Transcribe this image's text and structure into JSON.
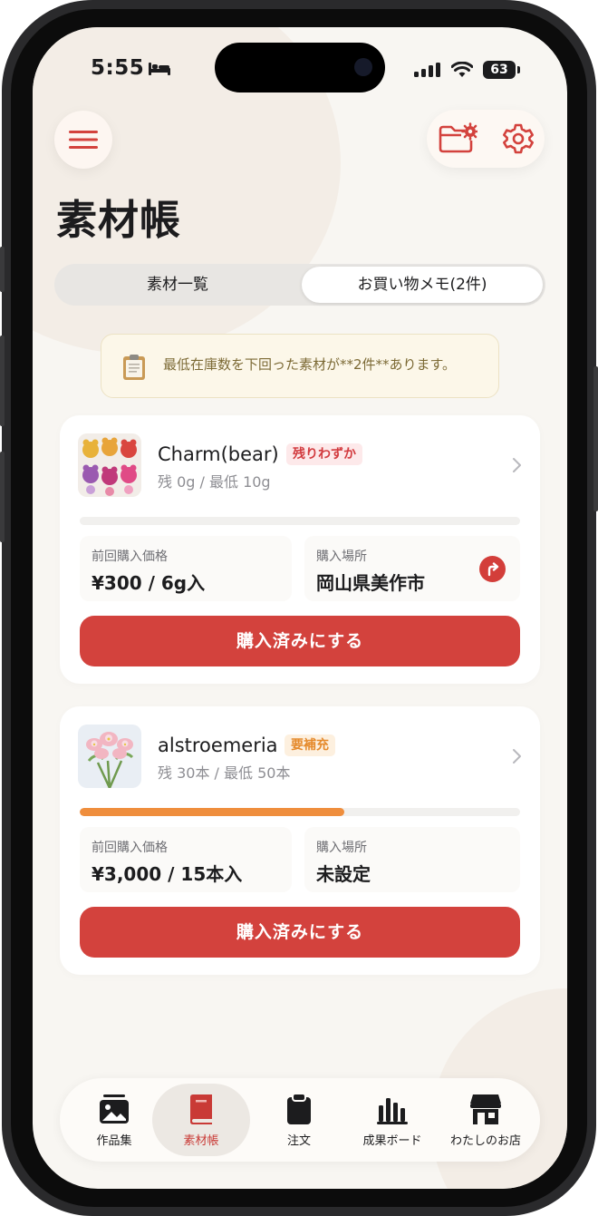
{
  "status_bar": {
    "time": "5:55",
    "battery": "63"
  },
  "header": {
    "title": "素材帳"
  },
  "segments": [
    {
      "label": "素材一覧",
      "selected": false
    },
    {
      "label": "お買い物メモ(2件)",
      "selected": true
    }
  ],
  "notice": {
    "text": "最低在庫数を下回った素材が**2件**あります。"
  },
  "items": [
    {
      "name": "Charm(bear)",
      "badge": "残りわずか",
      "stock": "残 0g / 最低 10g",
      "progress": 0,
      "price_label": "前回購入価格",
      "price": "¥300 / 6g入",
      "place_label": "購入場所",
      "place": "岡山県美作市",
      "button": "購入済みにする"
    },
    {
      "name": "alstroemeria",
      "badge": "要補充",
      "stock": "残 30本 / 最低 50本",
      "progress": 0.6,
      "price_label": "前回購入価格",
      "price": "¥3,000 / 15本入",
      "place_label": "購入場所",
      "place": "未設定",
      "button": "購入済みにする"
    }
  ],
  "tabbar": {
    "items": [
      {
        "label": "作品集",
        "icon": "gallery-icon"
      },
      {
        "label": "素材帳",
        "icon": "book-icon",
        "active": true
      },
      {
        "label": "注文",
        "icon": "clipboard-icon"
      },
      {
        "label": "成果ボード",
        "icon": "bar-chart-icon"
      },
      {
        "label": "わたしのお店",
        "icon": "store-icon"
      }
    ]
  },
  "colors": {
    "accent": "#d3423d",
    "warning": "#ef8e3d",
    "background": "#f8f6f2"
  }
}
